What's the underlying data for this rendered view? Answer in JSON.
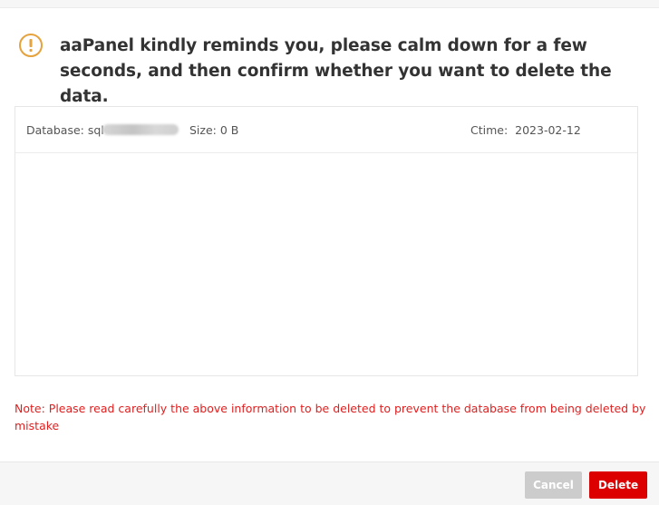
{
  "dialog": {
    "headline": "aaPanel kindly reminds you, please calm down for a few seconds, and then confirm whether you want to delete the data."
  },
  "database_row": {
    "database_label": "Database: sql",
    "size_label": "Size:",
    "size_value": "0 B",
    "ctime_label": "Ctime:",
    "ctime_value": "2023-02-12"
  },
  "note": "Note: Please read carefully the above information to be deleted to prevent the database from being deleted by mistake",
  "buttons": {
    "cancel": "Cancel",
    "delete": "Delete"
  },
  "colors": {
    "warning": "#e6a23c",
    "note_text": "#e02020",
    "delete_button": "#dc0000",
    "cancel_button": "#cccccc"
  }
}
